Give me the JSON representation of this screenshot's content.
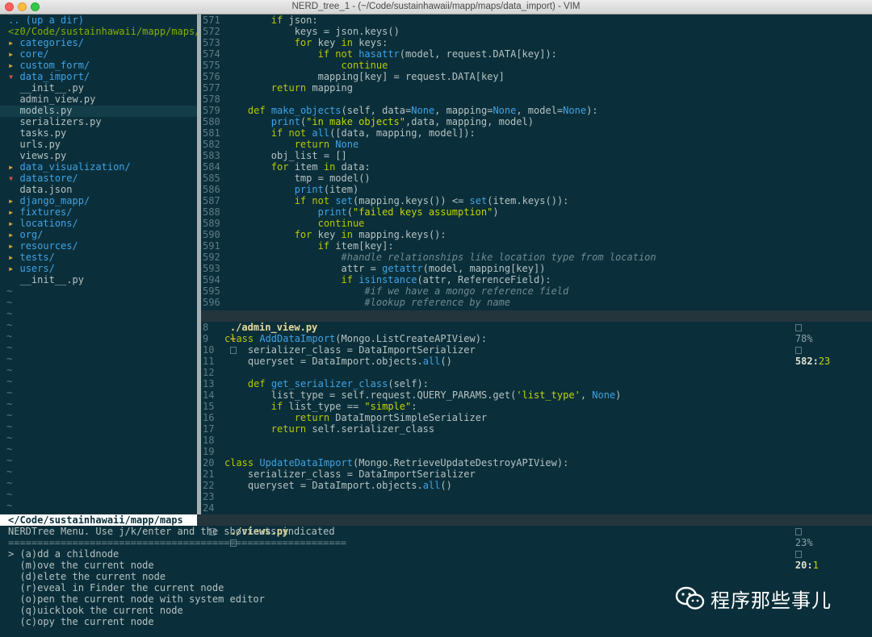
{
  "window": {
    "title": "NERD_tree_1 - (~/Code/sustainhawaii/mapp/maps/data_import) - VIM"
  },
  "tree": {
    "up": ".. (up a dir)",
    "root": "<z0/Code/sustainhawaii/mapp/maps/",
    "items": [
      {
        "kind": "dir",
        "arrow": "▸",
        "label": "categories/"
      },
      {
        "kind": "dir",
        "arrow": "▸",
        "label": "core/"
      },
      {
        "kind": "dir",
        "arrow": "▸",
        "label": "custom_form/"
      },
      {
        "kind": "diropen",
        "arrow": "▾",
        "label": "data_import/"
      },
      {
        "kind": "file",
        "label": "__init__.py"
      },
      {
        "kind": "file",
        "label": "admin_view.py"
      },
      {
        "kind": "file",
        "label": "models.py"
      },
      {
        "kind": "file",
        "label": "serializers.py"
      },
      {
        "kind": "file",
        "label": "tasks.py"
      },
      {
        "kind": "file",
        "label": "urls.py"
      },
      {
        "kind": "file",
        "label": "views.py"
      },
      {
        "kind": "dir",
        "arrow": "▸",
        "label": "data_visualization/"
      },
      {
        "kind": "diropen",
        "arrow": "▾",
        "label": "datastore/"
      },
      {
        "kind": "file",
        "label": "data.json"
      },
      {
        "kind": "dir",
        "arrow": "▸",
        "label": "django_mapp/"
      },
      {
        "kind": "dir",
        "arrow": "▸",
        "label": "fixtures/"
      },
      {
        "kind": "dir",
        "arrow": "▸",
        "label": "locations/"
      },
      {
        "kind": "dir",
        "arrow": "▸",
        "label": "org/"
      },
      {
        "kind": "dir",
        "arrow": "▸",
        "label": "resources/"
      },
      {
        "kind": "dir",
        "arrow": "▸",
        "label": "tests/"
      },
      {
        "kind": "dir",
        "arrow": "▸",
        "label": "users/"
      },
      {
        "kind": "rootfile",
        "label": "__init__.py"
      }
    ],
    "tilde": "~"
  },
  "editor_top": {
    "lines": [
      {
        "n": "571",
        "t": "        if json:"
      },
      {
        "n": "572",
        "t": "            keys = json.keys()"
      },
      {
        "n": "573",
        "t": "            for key in keys:"
      },
      {
        "n": "574",
        "t": "                if not hasattr(model, request.DATA[key]):"
      },
      {
        "n": "575",
        "t": "                    continue"
      },
      {
        "n": "576",
        "t": "                mapping[key] = request.DATA[key]"
      },
      {
        "n": "577",
        "t": "        return mapping"
      },
      {
        "n": "578",
        "t": ""
      },
      {
        "n": "579",
        "t": "    def make_objects(self, data=None, mapping=None, model=None):"
      },
      {
        "n": "580",
        "t": "        print(\"in make objects\",data, mapping, model)"
      },
      {
        "n": "581",
        "t": "        if not all([data, mapping, model]):"
      },
      {
        "n": "582",
        "t": "            return None"
      },
      {
        "n": "583",
        "t": "        obj_list = []"
      },
      {
        "n": "584",
        "t": "        for item in data:"
      },
      {
        "n": "585",
        "t": "            tmp = model()"
      },
      {
        "n": "586",
        "t": "            print(item)"
      },
      {
        "n": "587",
        "t": "            if not set(mapping.keys()) <= set(item.keys()):"
      },
      {
        "n": "588",
        "t": "                print(\"failed keys assumption\")"
      },
      {
        "n": "589",
        "t": "                continue"
      },
      {
        "n": "590",
        "t": "            for key in mapping.keys():"
      },
      {
        "n": "591",
        "t": "                if item[key]:"
      },
      {
        "n": "592",
        "t": "                    #handle relationships like location type from location"
      },
      {
        "n": "593",
        "t": "                    attr = getattr(model, mapping[key])"
      },
      {
        "n": "594",
        "t": "                    if isinstance(attr, ReferenceField):"
      },
      {
        "n": "595",
        "t": "                        #if we have a mongo reference field"
      },
      {
        "n": "596",
        "t": "                        #lookup reference by name"
      }
    ]
  },
  "status_top": {
    "file": "./admin_view.py",
    "modified": "+",
    "percent": "78%",
    "line": "582",
    "col": "23"
  },
  "editor_bottom": {
    "lines": [
      {
        "n": "8",
        "t": ""
      },
      {
        "n": "9",
        "t": "class AddDataImport(Mongo.ListCreateAPIView):"
      },
      {
        "n": "10",
        "t": "    serializer_class = DataImportSerializer"
      },
      {
        "n": "11",
        "t": "    queryset = DataImport.objects.all()"
      },
      {
        "n": "12",
        "t": ""
      },
      {
        "n": "13",
        "t": "    def get_serializer_class(self):"
      },
      {
        "n": "14",
        "t": "        list_type = self.request.QUERY_PARAMS.get('list_type', None)"
      },
      {
        "n": "15",
        "t": "        if list_type == \"simple\":"
      },
      {
        "n": "16",
        "t": "            return DataImportSimpleSerializer"
      },
      {
        "n": "17",
        "t": "        return self.serializer_class"
      },
      {
        "n": "18",
        "t": ""
      },
      {
        "n": "19",
        "t": ""
      },
      {
        "n": "20",
        "t": "class UpdateDataImport(Mongo.RetrieveUpdateDestroyAPIView):"
      },
      {
        "n": "21",
        "t": "    serializer_class = DataImportSerializer"
      },
      {
        "n": "22",
        "t": "    queryset = DataImport.objects.all()"
      },
      {
        "n": "23",
        "t": ""
      },
      {
        "n": "24",
        "t": ""
      }
    ]
  },
  "status_bottom": {
    "tree_path": "</Code/sustainhawaii/mapp/maps",
    "file": "./views.py",
    "percent": "23%",
    "line": "20",
    "col": "1"
  },
  "menu": {
    "title": "NERDTree Menu. Use j/k/enter and the shortcuts indicated",
    "rule": "==========================================================",
    "items": [
      "> (a)dd a childnode",
      "  (m)ove the current node",
      "  (d)elete the current node",
      "  (r)eveal in Finder the current node",
      "  (o)pen the current node with system editor",
      "  (q)uicklook the current node",
      "  (c)opy the current node"
    ]
  },
  "watermark": {
    "text": "程序那些事儿"
  },
  "colors": {
    "background": "#0b2f3a",
    "keyword": "#b7c800",
    "function": "#3fa3e6",
    "comment": "#6f8a92"
  }
}
